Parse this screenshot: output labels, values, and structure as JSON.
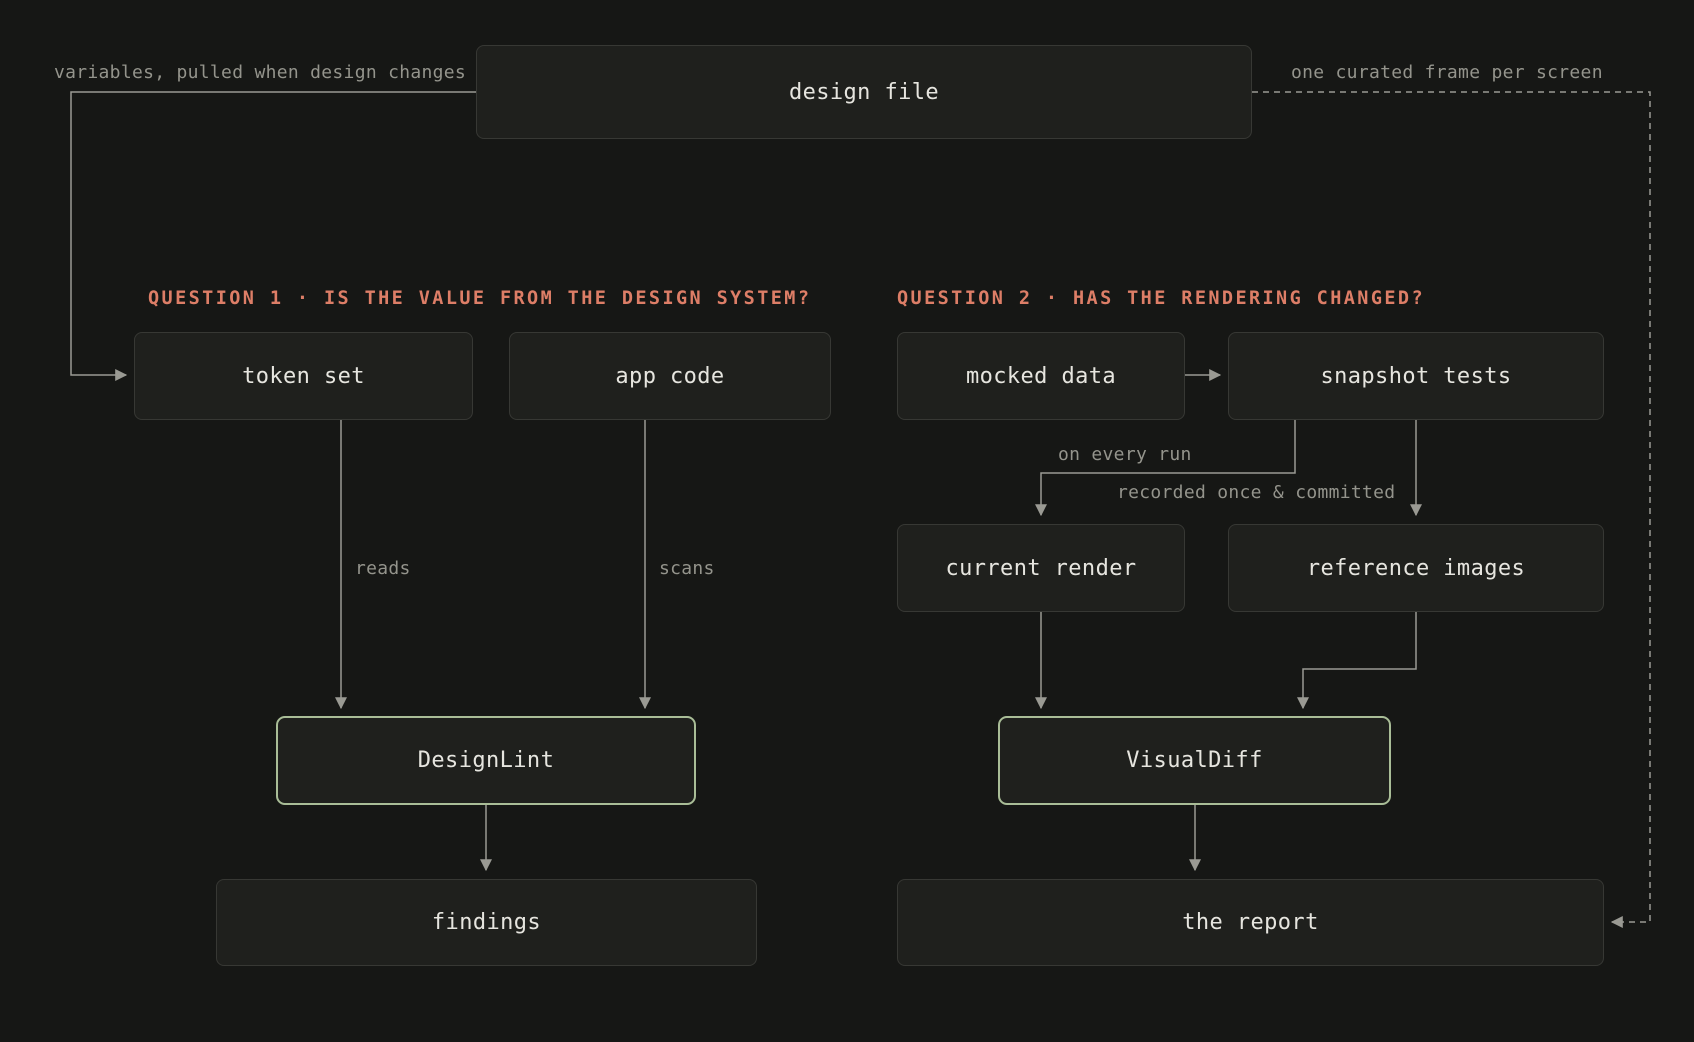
{
  "nodes": {
    "design_file": "design file",
    "token_set": "token set",
    "app_code": "app code",
    "mocked_data": "mocked data",
    "snapshot_tests": "snapshot tests",
    "current_render": "current render",
    "reference_images": "reference images",
    "designlint": "DesignLint",
    "visualdiff": "VisualDiff",
    "findings": "findings",
    "the_report": "the report"
  },
  "headings": {
    "question1": "QUESTION 1 · IS THE VALUE FROM THE DESIGN SYSTEM?",
    "question2": "QUESTION 2 · HAS THE RENDERING CHANGED?"
  },
  "edge_labels": {
    "variables": "variables, pulled when design changes",
    "curated": "one curated frame per screen",
    "reads": "reads",
    "scans": "scans",
    "every_run": "on every run",
    "recorded": "recorded once & committed"
  },
  "colors": {
    "background": "#161715",
    "node_fill": "#1f201d",
    "node_border": "#373834",
    "tool_border": "#a9bd97",
    "heading": "#dd7e67",
    "connector": "#9a9a93",
    "edge_label": "#94948c",
    "node_text": "#e6e5df"
  }
}
